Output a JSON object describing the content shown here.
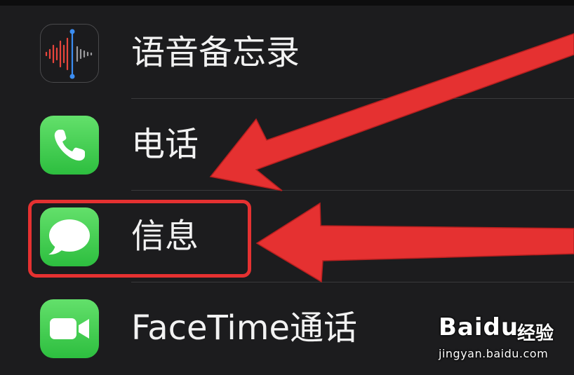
{
  "settings_list": {
    "items": [
      {
        "label": "语音备忘录",
        "icon": "voice-memos-icon"
      },
      {
        "label": "电话",
        "icon": "phone-icon"
      },
      {
        "label": "信息",
        "icon": "messages-icon"
      },
      {
        "label": "FaceTime通话",
        "icon": "facetime-icon"
      }
    ]
  },
  "annotations": {
    "highlight_color": "#e53131",
    "arrow_color": "#e53131"
  },
  "watermark": {
    "brand": "Bai",
    "brand_suffix": "du",
    "sub": "经验",
    "url": "jingyan.baidu.com"
  }
}
